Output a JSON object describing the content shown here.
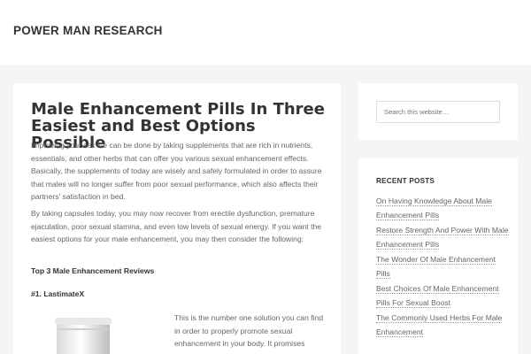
{
  "header": {
    "site_title": "POWER MAN RESEARCH"
  },
  "article": {
    "title": "Male Enhancement Pills In Three Easiest and Best Options Possible",
    "paragraph_1": "Improving your sex life can be done by taking supplements that are rich in nutrients, essentials, and other herbs that can offer you various sexual enhancement effects. Basically, the supplements of today are wisely and safely formulated in order to assure that males will no longer suffer from poor sexual performance, which also affects their partners' satisfaction in bed.",
    "paragraph_2": "By taking capsules today, you may now recover from erectile dysfunction, premature ejaculation, poor sexual stamina, and even low levels of sexual energy. If you want the easiest options for your male enhancement, you may then consider the following:",
    "subheading_1": "Top 3 Male Enhancement Reviews",
    "subheading_2": "#1. LastimateX",
    "paragraph_3": "This is the number one solution you can find in order to properly promote sexual enhancement in your body. It promises firmer, longer lasting erections and"
  },
  "sidebar": {
    "search_placeholder": "Search this website…",
    "recent_title": "RECENT POSTS",
    "recent_posts": [
      {
        "label": "On Having Knowledge About Male Enhancement Pills"
      },
      {
        "label": "Restore Strength And Power With Male Enhancement Pills"
      },
      {
        "label": "The Wonder Of Male Enhancement Pills"
      },
      {
        "label": "Best Choices Of Male Enhancement Pills For Sexual Boost"
      },
      {
        "label": "The Commonly Used Herbs For Male Enhancement"
      }
    ]
  },
  "colors": {
    "page_background": "#f5f5f5",
    "card_background": "#ffffff",
    "heading_text": "#333333",
    "body_text": "#666666"
  }
}
